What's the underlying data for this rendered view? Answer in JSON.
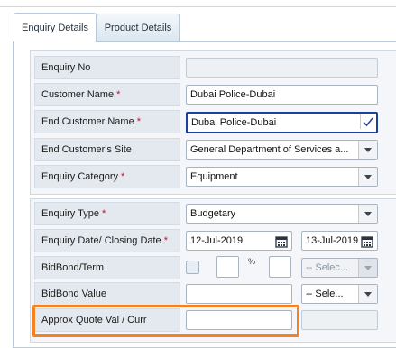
{
  "tabs": [
    {
      "label": "Enquiry Details",
      "active": true
    },
    {
      "label": "Product Details",
      "active": false
    }
  ],
  "fields": {
    "enquiry_no": {
      "label": "Enquiry No",
      "value": ""
    },
    "customer_name": {
      "label": "Customer Name",
      "required": "*",
      "value": "Dubai Police-Dubai"
    },
    "end_customer_name": {
      "label": "End Customer Name",
      "required": "*",
      "value": "Dubai Police-Dubai"
    },
    "end_customer_site": {
      "label": "End Customer's Site",
      "value": "General Department of Services a..."
    },
    "enquiry_category": {
      "label": "Enquiry Category",
      "required": "*",
      "value": "Equipment"
    },
    "enquiry_type": {
      "label": "Enquiry Type",
      "required": "*",
      "value": "Budgetary"
    },
    "enquiry_dates": {
      "label": "Enquiry Date/ Closing Date",
      "required": "*",
      "enquiry_date": "12-Jul-2019",
      "closing_date": "13-Jul-2019"
    },
    "bidbond_term": {
      "label": "BidBond/Term",
      "percent_symbol": "%",
      "select_placeholder": "-- Selec..."
    },
    "bidbond_value": {
      "label": "BidBond Value",
      "value": "",
      "select_placeholder": "-- Sele..."
    },
    "approx_quote": {
      "label": "Approx Quote Val / Curr",
      "value": ""
    }
  },
  "colors": {
    "accent_highlight": "#f58220",
    "focus_border": "#1f3f9c",
    "required": "#c8102e"
  }
}
